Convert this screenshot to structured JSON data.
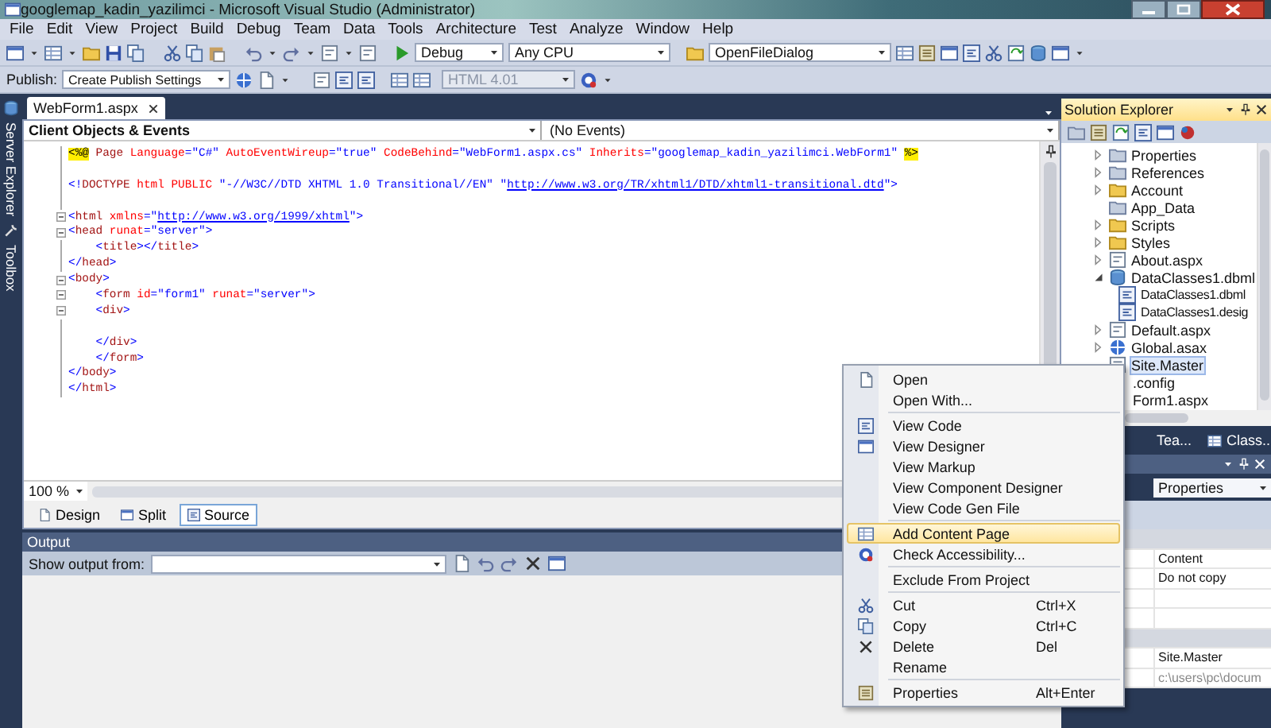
{
  "window": {
    "title": "googlemap_kadin_yazilimci - Microsoft Visual Studio (Administrator)"
  },
  "menu": [
    "File",
    "Edit",
    "View",
    "Project",
    "Build",
    "Debug",
    "Team",
    "Data",
    "Tools",
    "Architecture",
    "Test",
    "Analyze",
    "Window",
    "Help"
  ],
  "toolbar": {
    "configuration": "Debug",
    "platform": "Any CPU",
    "find": "OpenFileDialog"
  },
  "publish_toolbar": {
    "label": "Publish:",
    "settings": "Create Publish Settings",
    "schema": {
      "value": "HTML 4.01",
      "disabled": true
    }
  },
  "side_tabs": [
    "Server Explorer",
    "Toolbox"
  ],
  "editor": {
    "tabs": [
      {
        "label": "WebForm1.aspx",
        "selected": true
      }
    ],
    "object_list": "Client Objects & Events",
    "event_list": "(No Events)",
    "lines": [
      {
        "kind": "plain",
        "tokens": [
          {
            "kind": "delim",
            "text": "<%@"
          },
          {
            "kind": "tag",
            "text": " Page "
          },
          {
            "kind": "attr",
            "text": "Language"
          },
          {
            "kind": "punct",
            "text": "="
          },
          {
            "kind": "value",
            "text": "\"C#\" "
          },
          {
            "kind": "attr",
            "text": "AutoEventWireup"
          },
          {
            "kind": "punct",
            "text": "="
          },
          {
            "kind": "value",
            "text": "\"true\" "
          },
          {
            "kind": "attr",
            "text": "CodeBehind"
          },
          {
            "kind": "punct",
            "text": "="
          },
          {
            "kind": "value",
            "text": "\"WebForm1.aspx.cs\" "
          },
          {
            "kind": "attr",
            "text": "Inherits"
          },
          {
            "kind": "punct",
            "text": "="
          },
          {
            "kind": "value",
            "text": "\"googlemap_kadin_yazilimci.WebForm1\" "
          },
          {
            "kind": "delim",
            "text": "%>"
          }
        ]
      },
      {
        "kind": "plain"
      },
      {
        "kind": "plain",
        "tokens": [
          {
            "kind": "punct",
            "text": "<!"
          },
          {
            "kind": "tag",
            "text": "DOCTYPE"
          },
          {
            "kind": "attr",
            "text": " html PUBLIC "
          },
          {
            "kind": "value",
            "text": "\"-//W3C//DTD XHTML 1.0 Transitional//EN\" \""
          },
          {
            "kind": "link",
            "text": "http://www.w3.org/TR/xhtml1/DTD/xhtml1-transitional.dtd"
          },
          {
            "kind": "value",
            "text": "\""
          },
          {
            "kind": "punct",
            "text": ">"
          }
        ]
      },
      {
        "kind": "plain"
      },
      {
        "kind": "fold",
        "tokens": [
          {
            "kind": "punct",
            "text": "<"
          },
          {
            "kind": "tag",
            "text": "html "
          },
          {
            "kind": "attr",
            "text": "xmlns"
          },
          {
            "kind": "punct",
            "text": "=\""
          },
          {
            "kind": "link",
            "text": "http://www.w3.org/1999/xhtml"
          },
          {
            "kind": "punct",
            "text": "\">"
          }
        ]
      },
      {
        "kind": "fold",
        "tokens": [
          {
            "kind": "punct",
            "text": "<"
          },
          {
            "kind": "tag",
            "text": "head "
          },
          {
            "kind": "attr",
            "text": "runat"
          },
          {
            "kind": "punct",
            "text": "="
          },
          {
            "kind": "value",
            "text": "\"server\""
          },
          {
            "kind": "punct",
            "text": ">"
          }
        ]
      },
      {
        "kind": "plain",
        "tokens": [
          {
            "kind": "punct",
            "text": "    <"
          },
          {
            "kind": "tag",
            "text": "title"
          },
          {
            "kind": "punct",
            "text": "></"
          },
          {
            "kind": "tag",
            "text": "title"
          },
          {
            "kind": "punct",
            "text": ">"
          }
        ]
      },
      {
        "kind": "plain",
        "tokens": [
          {
            "kind": "punct",
            "text": "</"
          },
          {
            "kind": "tag",
            "text": "head"
          },
          {
            "kind": "punct",
            "text": ">"
          }
        ]
      },
      {
        "kind": "fold",
        "tokens": [
          {
            "kind": "punct",
            "text": "<"
          },
          {
            "kind": "tag",
            "text": "body"
          },
          {
            "kind": "punct",
            "text": ">"
          }
        ]
      },
      {
        "kind": "fold",
        "tokens": [
          {
            "kind": "punct",
            "text": "    <"
          },
          {
            "kind": "tag",
            "text": "form "
          },
          {
            "kind": "attr",
            "text": "id"
          },
          {
            "kind": "punct",
            "text": "="
          },
          {
            "kind": "value",
            "text": "\"form1\" "
          },
          {
            "kind": "attr",
            "text": "runat"
          },
          {
            "kind": "punct",
            "text": "="
          },
          {
            "kind": "value",
            "text": "\"server\""
          },
          {
            "kind": "punct",
            "text": ">"
          }
        ]
      },
      {
        "kind": "fold",
        "tokens": [
          {
            "kind": "punct",
            "text": "    <"
          },
          {
            "kind": "tag",
            "text": "div"
          },
          {
            "kind": "punct",
            "text": ">"
          }
        ]
      },
      {
        "kind": "plain"
      },
      {
        "kind": "plain",
        "tokens": [
          {
            "kind": "punct",
            "text": "    </"
          },
          {
            "kind": "tag",
            "text": "div"
          },
          {
            "kind": "punct",
            "text": ">"
          }
        ]
      },
      {
        "kind": "plain",
        "tokens": [
          {
            "kind": "punct",
            "text": "    </"
          },
          {
            "kind": "tag",
            "text": "form"
          },
          {
            "kind": "punct",
            "text": ">"
          }
        ]
      },
      {
        "kind": "plain",
        "tokens": [
          {
            "kind": "punct",
            "text": "</"
          },
          {
            "kind": "tag",
            "text": "body"
          },
          {
            "kind": "punct",
            "text": ">"
          }
        ]
      },
      {
        "kind": "plain",
        "tokens": [
          {
            "kind": "punct",
            "text": "</"
          },
          {
            "kind": "tag",
            "text": "html"
          },
          {
            "kind": "punct",
            "text": ">"
          }
        ]
      }
    ],
    "zoom": "100 %",
    "views": [
      {
        "label": "Design",
        "selected": false
      },
      {
        "label": "Split",
        "selected": false
      },
      {
        "label": "Source",
        "selected": true
      }
    ]
  },
  "output": {
    "title": "Output",
    "source_label": "Show output from:"
  },
  "solution_explorer": {
    "title": "Solution Explorer",
    "items": [
      {
        "label": "Properties",
        "kind": "special",
        "expanded": false,
        "selected": false
      },
      {
        "label": "References",
        "kind": "special",
        "expanded": false,
        "selected": false
      },
      {
        "label": "Account",
        "kind": "folder",
        "expanded": false,
        "selected": false
      },
      {
        "label": "App_Data",
        "kind": "special",
        "selected": false
      },
      {
        "label": "Scripts",
        "kind": "folder",
        "expanded": false,
        "selected": false
      },
      {
        "label": "Styles",
        "kind": "folder",
        "expanded": false,
        "selected": false
      },
      {
        "label": "About.aspx",
        "kind": "page",
        "expanded": false,
        "selected": false
      },
      {
        "label": "DataClasses1.dbml",
        "kind": "data",
        "expanded": true,
        "selected": false,
        "children": [
          {
            "label": "DataClasses1.dbml",
            "kind": "code",
            "selected": false
          },
          {
            "label": "DataClasses1.desig",
            "kind": "code",
            "selected": false
          }
        ]
      },
      {
        "label": "Default.aspx",
        "kind": "page",
        "expanded": false,
        "selected": false
      },
      {
        "label": "Global.asax",
        "kind": "global",
        "expanded": false,
        "selected": false
      },
      {
        "label": "Site.Master",
        "kind": "page",
        "selected": true
      },
      {
        "label": ".config",
        "kind": "covered",
        "selected": false
      },
      {
        "label": "Form1.aspx",
        "kind": "covered",
        "selected": false
      }
    ]
  },
  "panel_tabs": [
    "Tea...",
    "Class..."
  ],
  "properties": {
    "object": "Properties",
    "rows": [
      {
        "kind": "category"
      },
      {
        "kind": "row",
        "value": "Content",
        "disabled": false
      },
      {
        "kind": "row",
        "value": "Do not copy",
        "disabled": false
      },
      {
        "kind": "row"
      },
      {
        "kind": "row"
      },
      {
        "kind": "category"
      },
      {
        "kind": "row",
        "value": "Site.Master",
        "disabled": false
      },
      {
        "kind": "row",
        "value": "c:\\users\\pc\\docum",
        "disabled": true
      }
    ]
  },
  "context_menu": {
    "groups": [
      [
        {
          "label": "Open",
          "kind": "open",
          "selected": false
        },
        {
          "label": "Open With...",
          "kind": "plain",
          "selected": false
        }
      ],
      [
        {
          "label": "View Code",
          "kind": "code",
          "selected": false
        },
        {
          "label": "View Designer",
          "kind": "designer",
          "selected": false
        },
        {
          "label": "View Markup",
          "kind": "plain",
          "selected": false
        },
        {
          "label": "View Component Designer",
          "kind": "plain",
          "selected": false
        },
        {
          "label": "View Code Gen File",
          "kind": "plain",
          "selected": false
        }
      ],
      [
        {
          "label": "Add Content Page",
          "kind": "page",
          "selected": true
        },
        {
          "label": "Check Accessibility...",
          "kind": "accessibility",
          "selected": false
        }
      ],
      [
        {
          "label": "Exclude From Project",
          "kind": "plain",
          "selected": false
        }
      ],
      [
        {
          "label": "Cut",
          "kind": "cut",
          "shortcut": "Ctrl+X",
          "selected": false
        },
        {
          "label": "Copy",
          "kind": "copy",
          "shortcut": "Ctrl+C",
          "selected": false
        },
        {
          "label": "Delete",
          "kind": "delete",
          "shortcut": "Del",
          "selected": false
        },
        {
          "label": "Rename",
          "kind": "plain",
          "selected": false
        }
      ],
      [
        {
          "label": "Properties",
          "kind": "properties",
          "shortcut": "Alt+Enter",
          "selected": false
        }
      ]
    ]
  }
}
